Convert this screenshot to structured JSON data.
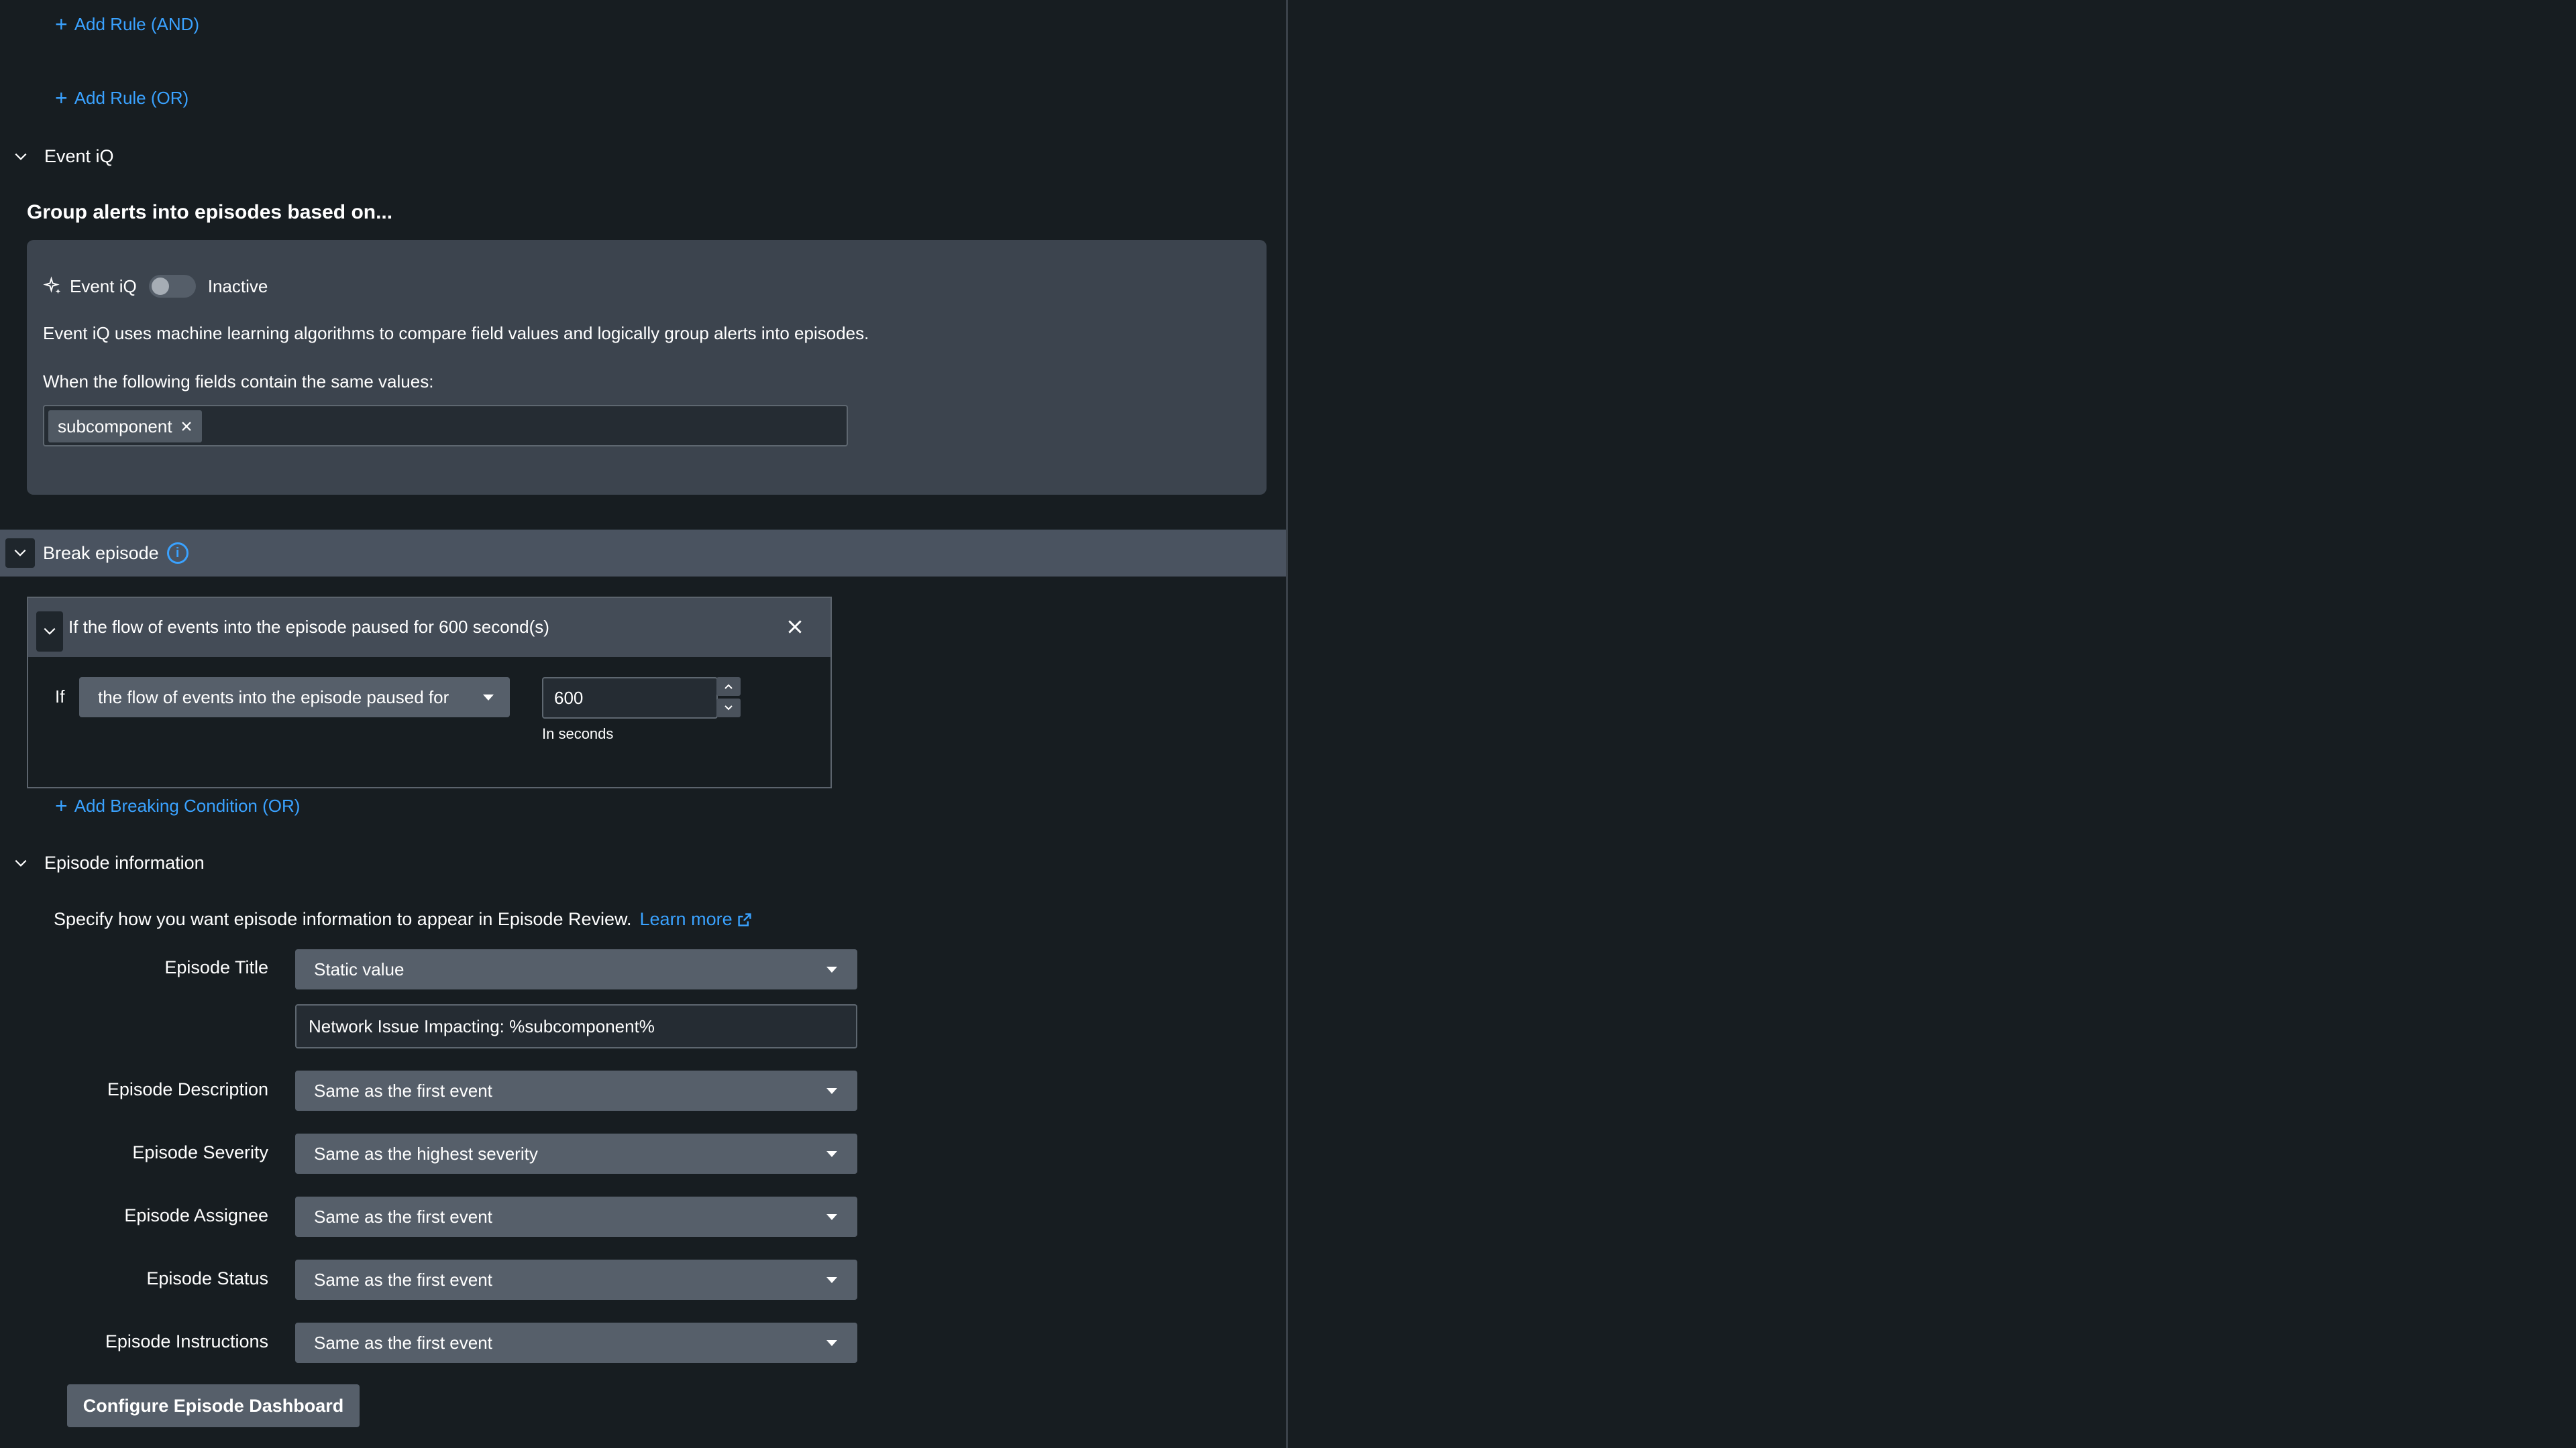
{
  "rules": {
    "add_and": "Add Rule (AND)",
    "add_or": "Add Rule (OR)"
  },
  "event_iq_section": {
    "header": "Event iQ",
    "group_title": "Group alerts into episodes based on...",
    "label": "Event iQ",
    "toggle_state": "Inactive",
    "description": "Event iQ uses machine learning algorithms to compare field values and logically group alerts into episodes.",
    "fields_label": "When the following fields contain the same values:",
    "fields": [
      "subcomponent"
    ]
  },
  "break_episode": {
    "header": "Break episode",
    "info_icon": "i",
    "condition_title": "If the flow of events into the episode paused for 600 second(s)",
    "if_label": "If",
    "condition_select": "the flow of events into the episode paused for",
    "seconds_value": "600",
    "seconds_hint": "In seconds",
    "add_condition": "Add Breaking Condition (OR)"
  },
  "episode_info": {
    "header": "Episode information",
    "description": "Specify how you want episode information to appear in Episode Review.",
    "learn_more": "Learn more",
    "title_label": "Episode Title",
    "title_select": "Static value",
    "title_value": "Network Issue Impacting: %subcomponent%",
    "fields": [
      {
        "label": "Episode Description",
        "value": "Same as the first event"
      },
      {
        "label": "Episode Severity",
        "value": "Same as the highest severity"
      },
      {
        "label": "Episode Assignee",
        "value": "Same as the first event"
      },
      {
        "label": "Episode Status",
        "value": "Same as the first event"
      },
      {
        "label": "Episode Instructions",
        "value": "Same as the first event"
      }
    ],
    "configure_button": "Configure Episode Dashboard"
  },
  "colors": {
    "background": "#171d21",
    "panel": "#3c444e",
    "accent_link": "#3aa2ff",
    "section_bar": "#4a5360"
  }
}
